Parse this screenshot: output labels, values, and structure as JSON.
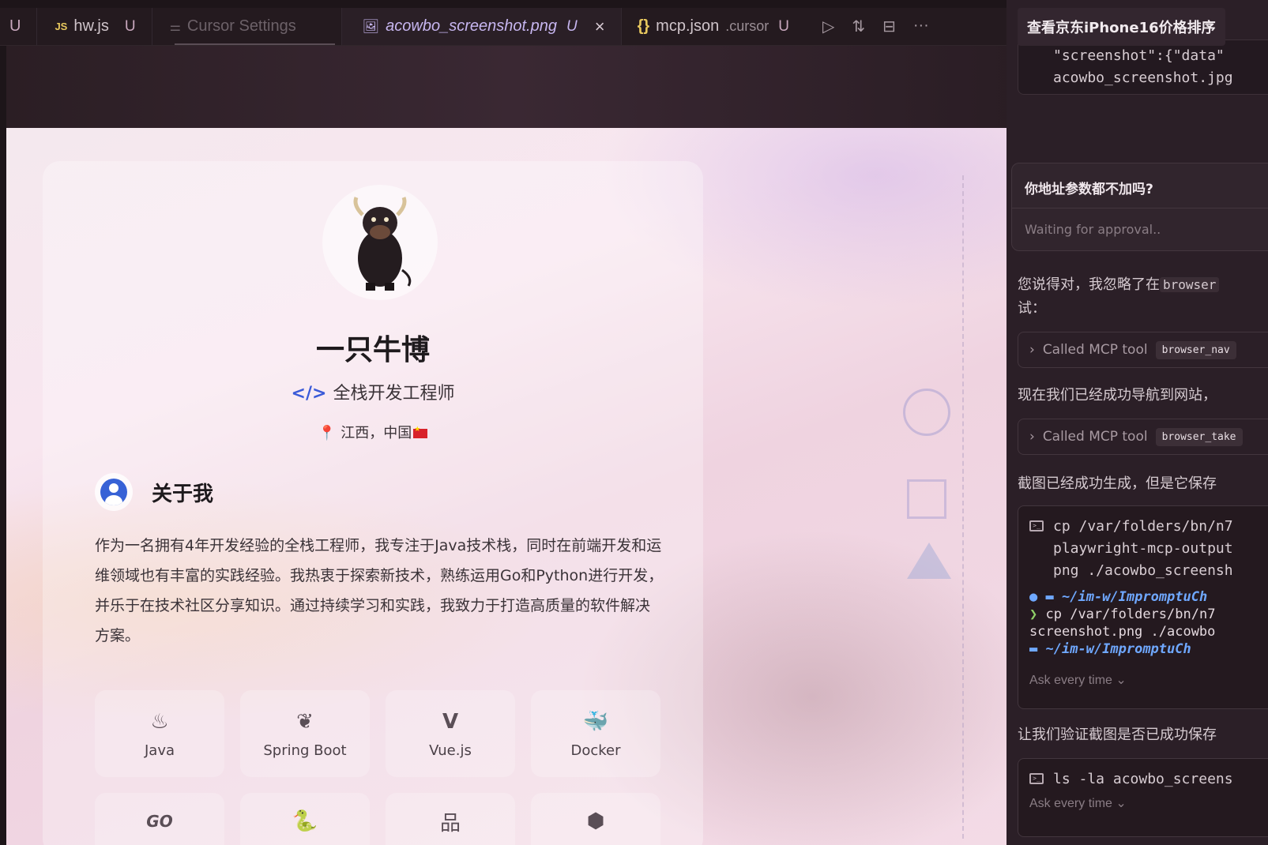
{
  "tabs": [
    {
      "label": "U",
      "badge": ""
    },
    {
      "icon": "JS",
      "label": "hw.js",
      "badge": "U"
    },
    {
      "label": "Cursor Settings",
      "badge": ""
    },
    {
      "label": "acowbo_screenshot.png",
      "badge": "U",
      "close": "×"
    },
    {
      "icon": "{}",
      "label": "mcp.json",
      "sub": ".cursor",
      "badge": "U"
    }
  ],
  "tab_actions": [
    "run-icon",
    "compare-icon",
    "split-icon",
    "more-icon"
  ],
  "profile": {
    "name": "一只牛博",
    "title": "全栈开发工程师",
    "code_symbol": "</>",
    "location": "江西，中国",
    "about_title": "关于我",
    "about_text": "作为一名拥有4年开发经验的全栈工程师，我专注于Java技术栈，同时在前端开发和运维领域也有丰富的实践经验。我热衷于探索新技术，熟练运用Go和Python进行开发，并乐于在技术社区分享知识。通过持续学习和实践，我致力于打造高质量的软件解决方案。",
    "skills": [
      {
        "label": "Java",
        "icon": "♨"
      },
      {
        "label": "Spring Boot",
        "icon": "❦"
      },
      {
        "label": "Vue.js",
        "icon": "V"
      },
      {
        "label": "Docker",
        "icon": "🐳"
      }
    ],
    "skills_row2": [
      {
        "label": "",
        "icon": "GO"
      },
      {
        "label": "",
        "icon": "🐍"
      },
      {
        "label": "",
        "icon": "品"
      },
      {
        "label": "",
        "icon": "⬢"
      }
    ]
  },
  "chat": {
    "title": "查看京东iPhone16价格排序",
    "top_code": [
      "\"screenshot\":{\"data\"",
      "acowbo_screenshot.jpg"
    ],
    "user_question": "你地址参数都不加吗?",
    "waiting": "Waiting for approval..",
    "msg1_line1": "您说得对，我忽略了在",
    "msg1_inline": "browser",
    "msg1_line2": "试：",
    "tool1_label": "Called MCP tool",
    "tool1_name": "browser_nav",
    "msg2": "现在我们已经成功导航到网站，",
    "tool2_label": "Called MCP tool",
    "tool2_name": "browser_take",
    "msg3": "截图已经成功生成，但是它保存",
    "term1_cmd": [
      "cp /var/folders/bn/n7",
      "playwright-mcp-output",
      "png ./acowbo_screensh"
    ],
    "term1_out_path": "~/im-w/ImpromptuCh",
    "term1_out_cmd": "cp /var/folders/bn/n7",
    "term1_out_line2": "screenshot.png ./acowbo",
    "term1_out_path2": "~/im-w/ImpromptuCh",
    "ask1": "Ask every time",
    "msg4": "让我们验证截图是否已成功保存",
    "term2_cmd": "ls -la acowbo_screens",
    "ask2": "Ask every time"
  }
}
